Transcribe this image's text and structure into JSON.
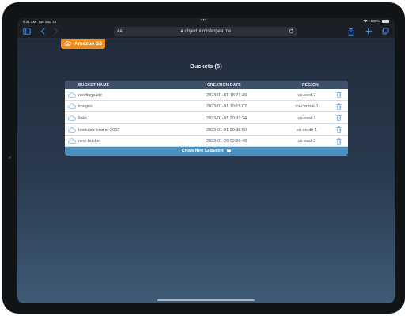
{
  "status_bar": {
    "time": "9:41 AM",
    "date": "Tue Sep 14",
    "battery": "100%"
  },
  "browser": {
    "text_size_label": "AA",
    "url": "objectui.misterpea.me"
  },
  "brand": {
    "logo_text": "Amazon S3",
    "accent_color": "#ef8d1e"
  },
  "page": {
    "title": "Buckets (5)"
  },
  "table": {
    "headers": {
      "name": "BUCKET NAME",
      "date": "CREATION DATE",
      "region": "REGION"
    },
    "rows": [
      {
        "name": "readings-etc",
        "date": "2023-01-01 18:21:49",
        "region": "us-east-2"
      },
      {
        "name": "images",
        "date": "2023-01-01 19:15:02",
        "region": "ca-central-1"
      },
      {
        "name": "links",
        "date": "2023-01-01 20:31:24",
        "region": "us-east-1"
      },
      {
        "name": "leetcode-end-of-2022",
        "date": "2023-01-01 20:35:50",
        "region": "eu-south-1"
      },
      {
        "name": "new-bucket",
        "date": "2023-01-26 02:26:48",
        "region": "us-east-2"
      }
    ],
    "create_label": "Create New S3 Bucket"
  },
  "icons": {
    "row_icon": "cloud-icon",
    "row_action": "trash-icon",
    "create_icon": "plus-circle-icon"
  }
}
